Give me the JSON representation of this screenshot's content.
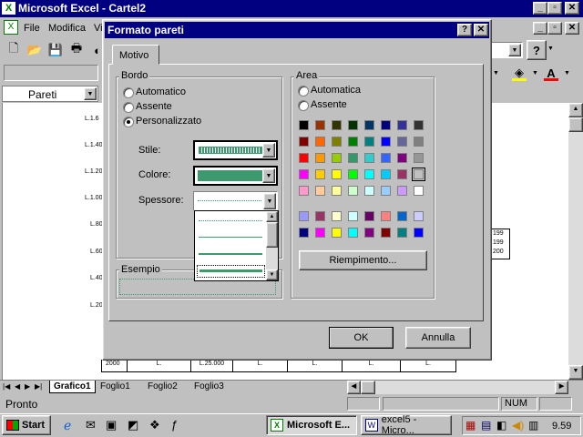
{
  "app": {
    "title": "Microsoft Excel - Cartel2",
    "menu": [
      "File",
      "Modifica",
      "Vi"
    ],
    "name_box": "Pareti",
    "help_btn": "?"
  },
  "dialog": {
    "title": "Formato pareti",
    "tab": "Motivo",
    "bordo": {
      "legend": "Bordo",
      "options": [
        "Automatico",
        "Assente",
        "Personalizzato"
      ],
      "selected": 2,
      "stile_label": "Stile:",
      "colore_label": "Colore:",
      "spessore_label": "Spessore:",
      "colore_value": "#3c9a6e"
    },
    "area": {
      "legend": "Area",
      "options": [
        "Automatica",
        "Assente"
      ],
      "fill_button": "Riempimento..."
    },
    "esempio": "Esempio",
    "ok": "OK",
    "cancel": "Annulla",
    "palette_top": [
      [
        "#000000",
        "#993300",
        "#333300",
        "#003300",
        "#003366",
        "#000080",
        "#333399",
        "#333333"
      ],
      [
        "#800000",
        "#ff6600",
        "#808000",
        "#008000",
        "#008080",
        "#0000ff",
        "#666699",
        "#808080"
      ],
      [
        "#ff0000",
        "#ff9900",
        "#99cc00",
        "#339966",
        "#33cccc",
        "#3366ff",
        "#800080",
        "#969696"
      ],
      [
        "#ff00ff",
        "#ffcc00",
        "#ffff00",
        "#00ff00",
        "#00ffff",
        "#00ccff",
        "#993366",
        "#c0c0c0"
      ],
      [
        "#ff99cc",
        "#ffcc99",
        "#ffff99",
        "#ccffcc",
        "#ccffff",
        "#99ccff",
        "#cc99ff",
        "#ffffff"
      ]
    ],
    "palette_bottom": [
      [
        "#9999ff",
        "#993366",
        "#ffffcc",
        "#ccffff",
        "#660066",
        "#ff8080",
        "#0066cc",
        "#ccccff"
      ],
      [
        "#000080",
        "#ff00ff",
        "#ffff00",
        "#00ffff",
        "#800080",
        "#800000",
        "#008080",
        "#0000ff"
      ]
    ]
  },
  "chart": {
    "y_labels": [
      "L.1.6",
      "L.1.40",
      "L.1.20",
      "L.1.00",
      "L.80",
      "L.60",
      "L.40",
      "L.20"
    ],
    "legend_labels": [
      "199",
      "199",
      "200"
    ],
    "table_first": "2000",
    "table_cells": [
      "L.",
      "L.25.000",
      "L.",
      "L.",
      "L.",
      "L."
    ]
  },
  "sheets": [
    "Grafico1",
    "Foglio1",
    "Foglio2",
    "Foglio3"
  ],
  "status": {
    "ready": "Pronto",
    "num": "NUM"
  },
  "taskbar": {
    "start": "Start",
    "task1": "Microsoft E...",
    "task2": "excel5 - Micro...",
    "clock": "9.59"
  }
}
